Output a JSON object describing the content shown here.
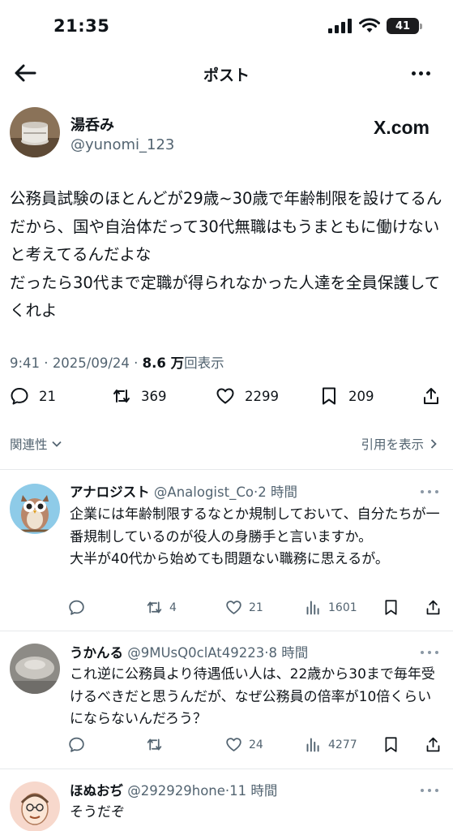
{
  "status": {
    "time": "21:35",
    "battery": "41"
  },
  "nav": {
    "title": "ポスト"
  },
  "post": {
    "author_name": "湯呑み",
    "author_handle": "@yunomi_123",
    "source_logo": "X.com",
    "text": "公務員試験のほとんどが29歳~30歳で年齢制限を設けてるんだから、国や自治体だって30代無職はもうまともに働けないと考えてるんだよな\nだったら30代まで定職が得られなかった人達を全員保護してくれよ",
    "time": "9:41",
    "sep": " · ",
    "date": "2025/09/24",
    "views_num": "8.6 万",
    "views_label": "回表示",
    "replies": "21",
    "reposts": "369",
    "likes": "2299",
    "bookmarks": "209"
  },
  "sort": {
    "label": "関連性",
    "quote_link": "引用を表示"
  },
  "replies": [
    {
      "name": "アナロジスト",
      "handle": "@Analogist_Co",
      "dot": "·",
      "time": "2 時間",
      "text": "企業には年齢制限するなとか規制しておいて、自分たちが一番規制しているのが役人の身勝手と言いますか。\n大半が40代から始めても問題ない職務に思えるが。",
      "replies": "",
      "reposts": "4",
      "likes": "21",
      "views": "1601"
    },
    {
      "name": "うかんる",
      "handle": "@9MUsQ0clAt49223",
      "dot": "·",
      "time": "8 時間",
      "text": "これ逆に公務員より待遇低い人は、22歳から30まで毎年受けるべきだと思うんだが、なぜ公務員の倍率が10倍くらいにならないんだろう？",
      "replies": "",
      "reposts": "",
      "likes": "24",
      "views": "4277"
    },
    {
      "name": "ほぬおぢ",
      "handle": "@292929hone",
      "dot": "·",
      "time": "11 時間",
      "text": "そうだぞ"
    }
  ],
  "colors": {
    "text": "#0f1419",
    "secondary": "#536471",
    "divider": "#e6e9eb"
  }
}
